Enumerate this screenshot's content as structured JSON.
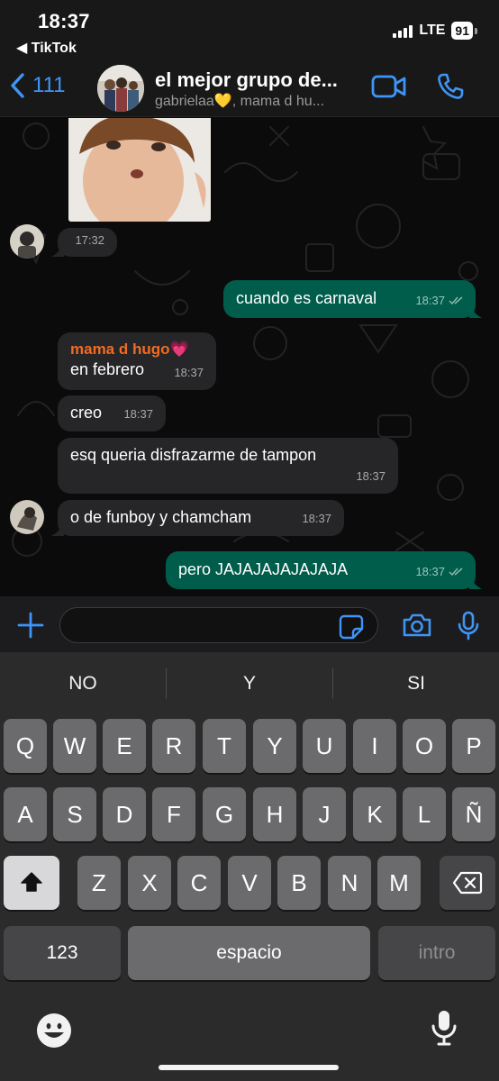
{
  "status_bar": {
    "time": "18:37",
    "back_app": "◀ TikTok",
    "network": "LTE",
    "battery": "91"
  },
  "header": {
    "back_count": "111",
    "title": "el mejor grupo de...",
    "subtitle": "gabrielaa💛, mama d hu...",
    "accent": "#3e95f7"
  },
  "messages": [
    {
      "direction": "in",
      "text": "",
      "time": "17:32"
    },
    {
      "direction": "out",
      "text": "cuando es carnaval",
      "time": "18:37"
    },
    {
      "direction": "in",
      "sender": "mama d hugo💗",
      "text": "en febrero",
      "time": "18:37"
    },
    {
      "direction": "in",
      "text": "creo",
      "time": "18:37"
    },
    {
      "direction": "in",
      "text": "esq queria disfrazarme de tampon",
      "time": "18:37"
    },
    {
      "direction": "in",
      "text": "o de funboy y chamcham",
      "time": "18:37"
    },
    {
      "direction": "out",
      "text": "pero JAJAJAJAJAJAJA",
      "time": "18:37"
    }
  ],
  "colors": {
    "outgoing_bubble": "#005c4b",
    "incoming_bubble": "#262628",
    "sender_name": "#f26b21"
  },
  "composer": {
    "value": "",
    "placeholder": ""
  },
  "keyboard": {
    "suggestions": [
      "NO",
      "Y",
      "SI"
    ],
    "row1": [
      "Q",
      "W",
      "E",
      "R",
      "T",
      "Y",
      "U",
      "I",
      "O",
      "P"
    ],
    "row2": [
      "A",
      "S",
      "D",
      "F",
      "G",
      "H",
      "J",
      "K",
      "L",
      "Ñ"
    ],
    "row3": [
      "Z",
      "X",
      "C",
      "V",
      "B",
      "N",
      "M"
    ],
    "numbers_key": "123",
    "space_key": "espacio",
    "return_key": "intro",
    "shift_icon": "shift-icon",
    "delete_icon": "backspace-icon",
    "emoji_icon": "emoji-icon",
    "dictation_icon": "microphone-icon"
  }
}
